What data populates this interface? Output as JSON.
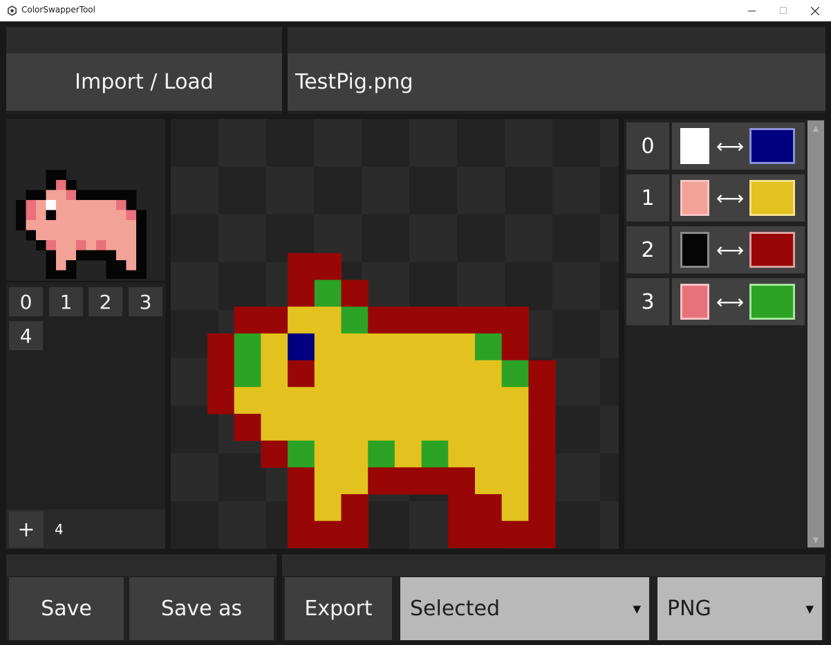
{
  "window": {
    "title": "ColorSwapperTool"
  },
  "top": {
    "import_label": "Import / Load",
    "filename": "TestPig.png"
  },
  "palettes": {
    "slots": [
      "0",
      "1",
      "2",
      "3",
      "4"
    ],
    "add_label": "+",
    "count": "4"
  },
  "swaps": [
    {
      "index": "0",
      "from": "#ffffff",
      "to": "#000080",
      "arrow": "⟷"
    },
    {
      "index": "1",
      "from": "#f3a298",
      "to": "#e3c21f",
      "arrow": "⟷"
    },
    {
      "index": "2",
      "from": "#050505",
      "to": "#990606",
      "arrow": "⟷"
    },
    {
      "index": "3",
      "from": "#e8717b",
      "to": "#2ca325",
      "arrow": "⟷"
    }
  ],
  "bottom": {
    "save_label": "Save",
    "save_as_label": "Save as",
    "export_label": "Export",
    "scope_value": "Selected",
    "format_value": "PNG"
  },
  "colors": {
    "yellow": "#e3c21f",
    "red": "#990606",
    "green": "#2ca325",
    "navy": "#000080",
    "pink": "#f3a298",
    "dark_pink": "#e8717b",
    "black": "#050505",
    "white": "#ffffff"
  }
}
